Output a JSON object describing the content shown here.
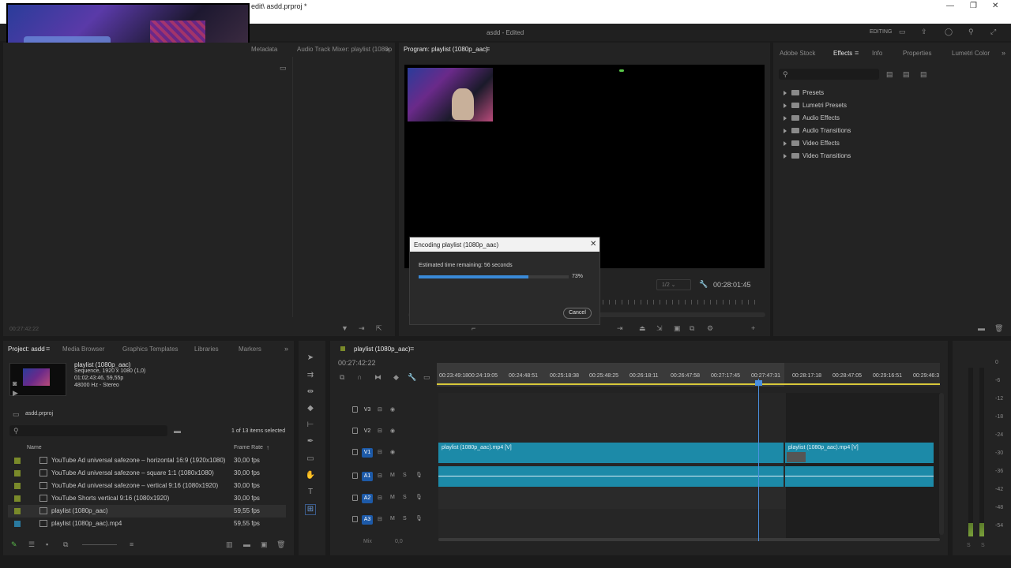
{
  "window": {
    "title": "edit\\ asdd.prproj *",
    "app_center": "asdd - Edited",
    "workspace": "EDITING"
  },
  "left_top": {
    "tabs": [
      "Metadata",
      "Audio Track Mixer: playlist (1080p"
    ],
    "timecode": "00:27:42:22"
  },
  "program": {
    "tab": "Program: playlist (1080p_aac)",
    "zoom": "1/2",
    "timecode": "00:28:01:45"
  },
  "dialog": {
    "title": "Encoding playlist (1080p_aac)",
    "remaining": "Estimated time remaining: 56 seconds",
    "progress": 0.73,
    "progress_label": "73%",
    "cancel": "Cancel"
  },
  "effects_panel": {
    "tabs": [
      "Adobe Stock",
      "Effects",
      "Info",
      "Properties",
      "Lumetri Color"
    ],
    "active_tab": "Effects",
    "items": [
      "Presets",
      "Lumetri Presets",
      "Audio Effects",
      "Audio Transitions",
      "Video Effects",
      "Video Transitions"
    ]
  },
  "project": {
    "tabs": [
      "Project: asdd",
      "Media Browser",
      "Graphics Templates",
      "Libraries",
      "Markers"
    ],
    "preview_name": "playlist (1080p_aac)",
    "preview_info1": "Sequence, 1920 x 1080 (1,0)",
    "preview_info2": "01:02:43:46, 59,55p",
    "preview_info3": "48000 Hz - Stereo",
    "file": "asdd.prproj",
    "selection": "1 of 13 items selected",
    "col_name": "Name",
    "col_frame": "Frame Rate",
    "rows": [
      {
        "name": "YouTube Ad universal safezone – horizontal 16:9 (1920x1080)",
        "fps": "30,00 fps",
        "color": "#7a8a2a"
      },
      {
        "name": "YouTube Ad universal safezone – square 1:1 (1080x1080)",
        "fps": "30,00 fps",
        "color": "#7a8a2a"
      },
      {
        "name": "YouTube Ad universal safezone – vertical 9:16 (1080x1920)",
        "fps": "30,00 fps",
        "color": "#7a8a2a"
      },
      {
        "name": "YouTube Shorts vertical 9:16 (1080x1920)",
        "fps": "30,00 fps",
        "color": "#7a8a2a"
      },
      {
        "name": "playlist (1080p_aac)",
        "fps": "59,55 fps",
        "color": "#7a8a2a"
      },
      {
        "name": "playlist (1080p_aac).mp4",
        "fps": "59,55 fps",
        "color": "#2a7aa0"
      }
    ]
  },
  "timeline": {
    "tab": "playlist (1080p_aac)",
    "timecode": "00:27:42:22",
    "ruler": [
      "00:23:49:18",
      "00:24:19:05",
      "00:24:48:51",
      "00:25:18:38",
      "00:25:48:25",
      "00:26:18:11",
      "00:26:47:58",
      "00:27:17:45",
      "00:27:47:31",
      "00:28:17:18",
      "00:28:47:05",
      "00:29:16:51",
      "00:29:46:3"
    ],
    "tracks": [
      "V3",
      "V2",
      "V1",
      "A1",
      "A2",
      "A3"
    ],
    "mix_label": "Mix",
    "mix_value": "0,0",
    "clip1": "playlist (1080p_aac).mp4 [V]",
    "clip2": "playlist (1080p_aac).mp4 [V]"
  },
  "meter": {
    "db": [
      "0",
      "-6",
      "-12",
      "-18",
      "-24",
      "-30",
      "-36",
      "-42",
      "-48",
      "-54"
    ],
    "solo": "S"
  }
}
